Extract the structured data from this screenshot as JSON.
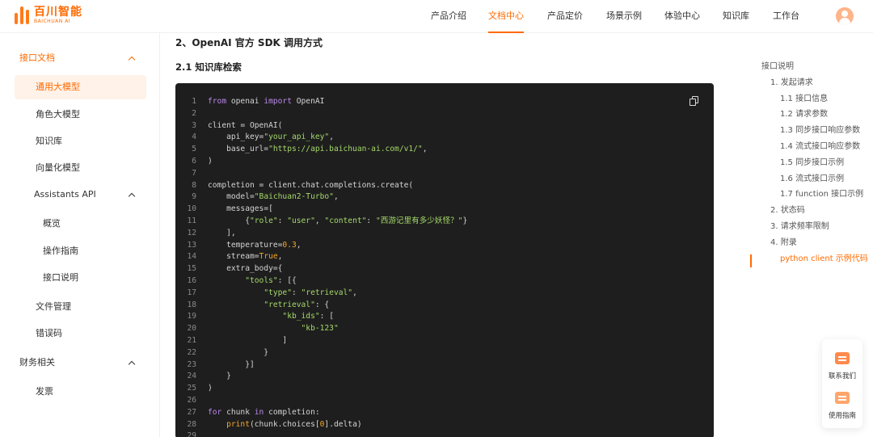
{
  "header": {
    "logo_cn": "百川智能",
    "logo_en": "BAICHUAN AI",
    "nav": [
      "产品介绍",
      "文档中心",
      "产品定价",
      "场景示例",
      "体验中心",
      "知识库",
      "工作台"
    ],
    "active_nav": "文档中心"
  },
  "sidebar": {
    "groups": [
      {
        "label": "接口文档",
        "expanded": true,
        "items": [
          "通用大模型",
          "角色大模型",
          "知识库",
          "向量化模型"
        ],
        "subgroup": {
          "label": "Assistants API",
          "items": [
            "概览",
            "操作指南",
            "接口说明"
          ]
        },
        "items_after": [
          "文件管理",
          "错误码"
        ]
      },
      {
        "label": "财务相关",
        "expanded": true,
        "items": [
          "发票"
        ]
      }
    ],
    "active_item": "通用大模型"
  },
  "main": {
    "section_title": "2、OpenAI 官方 SDK 调用方式",
    "subsection_title": "2.1 知识库检索",
    "code": [
      "from openai import OpenAI",
      "",
      "client = OpenAI(",
      "    api_key=\"your_api_key\",",
      "    base_url=\"https://api.baichuan-ai.com/v1/\",",
      ")",
      "",
      "completion = client.chat.completions.create(",
      "    model=\"Baichuan2-Turbo\",",
      "    messages=[",
      "        {\"role\": \"user\", \"content\": \"西游记里有多少妖怪？\"}",
      "    ],",
      "    temperature=0.3,",
      "    stream=True,",
      "    extra_body={",
      "        \"tools\": [{",
      "            \"type\": \"retrieval\",",
      "            \"retrieval\": {",
      "                \"kb_ids\": [",
      "                    \"kb-123\"",
      "                ]",
      "            }",
      "        }]",
      "    }",
      ")",
      "",
      "for chunk in completion:",
      "    print(chunk.choices[0].delta)",
      ""
    ]
  },
  "toc": {
    "items": [
      {
        "label": "接口说明",
        "level": 0
      },
      {
        "label": "1. 发起请求",
        "level": 1
      },
      {
        "label": "1.1 接口信息",
        "level": 2
      },
      {
        "label": "1.2 请求参数",
        "level": 2
      },
      {
        "label": "1.3 同步接口响应参数",
        "level": 2
      },
      {
        "label": "1.4 流式接口响应参数",
        "level": 2
      },
      {
        "label": "1.5 同步接口示例",
        "level": 2
      },
      {
        "label": "1.6 流式接口示例",
        "level": 2
      },
      {
        "label": "1.7 function 接口示例",
        "level": 2
      },
      {
        "label": "2. 状态码",
        "level": 1
      },
      {
        "label": "3. 请求频率限制",
        "level": 1
      },
      {
        "label": "4. 附录",
        "level": 1
      },
      {
        "label": "python client 示例代码",
        "level": 2
      }
    ],
    "active": "python client 示例代码"
  },
  "floating": {
    "contact": "联系我们",
    "guide": "使用指南"
  },
  "colors": {
    "accent": "#ff6a00",
    "active_bg": "#fff2e8",
    "code_bg": "#1e1e1e"
  }
}
